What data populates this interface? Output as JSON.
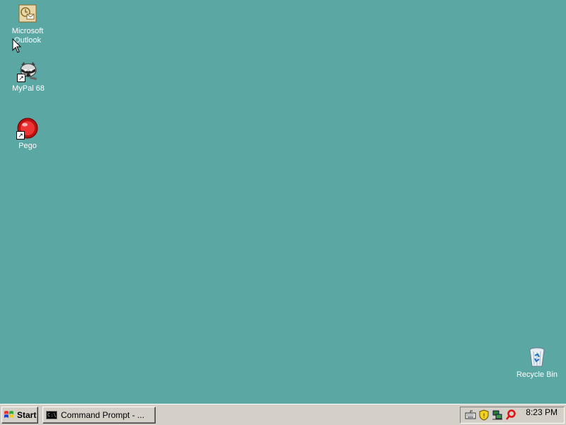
{
  "desktop": {
    "background_color": "#5aa7a4",
    "icons": [
      {
        "label_line1": "Microsoft",
        "label_line2": "Outlook",
        "icon": "outlook-icon"
      },
      {
        "label": "MyPal 68",
        "icon": "raccoon-icon"
      },
      {
        "label": "Pego",
        "icon": "pego-icon"
      },
      {
        "label": "Recycle Bin",
        "icon": "recycle-bin-icon"
      }
    ]
  },
  "taskbar": {
    "start_label": "Start",
    "tasks": [
      {
        "label": "Command Prompt - ...",
        "icon": "command-prompt-icon"
      }
    ],
    "tray_icons": [
      "keyboard-icon",
      "security-shield-icon",
      "network-icon",
      "search-icon"
    ],
    "clock": "8:23 PM"
  }
}
